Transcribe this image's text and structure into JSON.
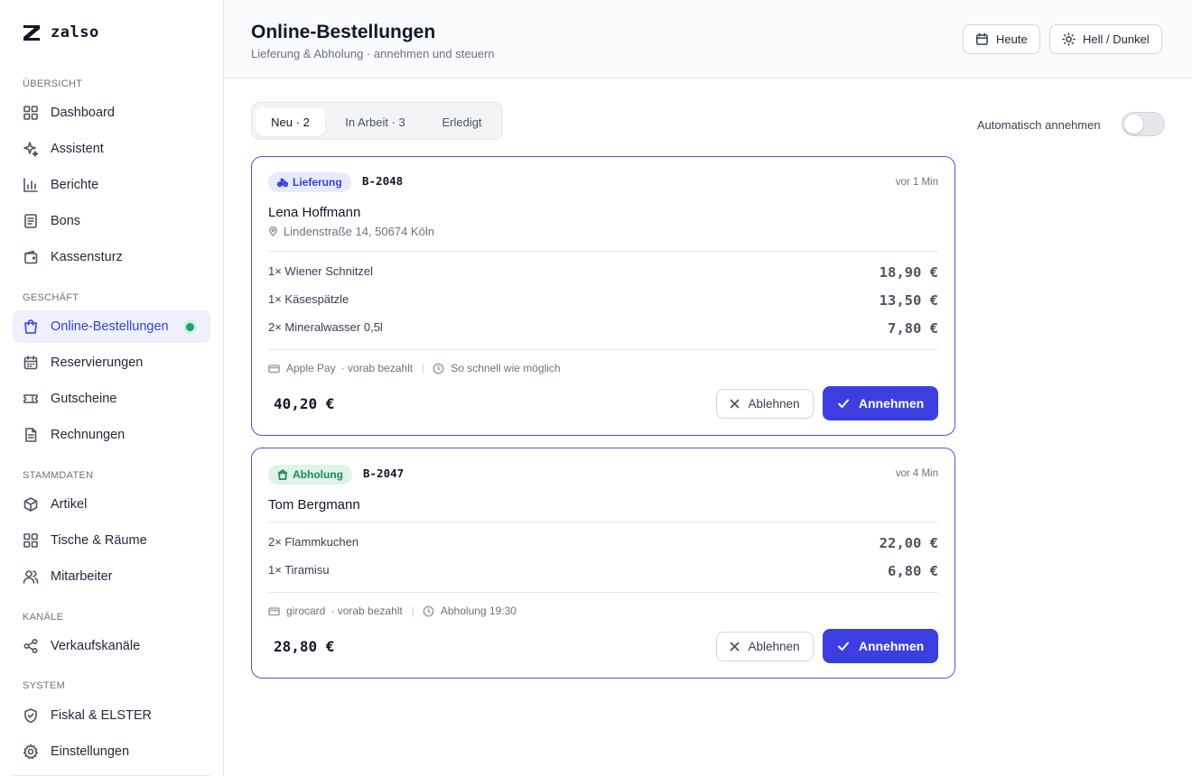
{
  "app": {
    "name": "zalso"
  },
  "sidebar": {
    "sections": [
      {
        "label": "Übersicht",
        "items": [
          {
            "label": "Dashboard",
            "icon": "grid-icon"
          },
          {
            "label": "Assistent",
            "icon": "sparkle-icon"
          },
          {
            "label": "Berichte",
            "icon": "bar-chart-icon"
          },
          {
            "label": "Bons",
            "icon": "receipt-icon"
          },
          {
            "label": "Kassensturz",
            "icon": "wallet-icon"
          }
        ]
      },
      {
        "label": "Geschäft",
        "items": [
          {
            "label": "Online-Bestellungen",
            "icon": "shopping-bag-icon",
            "active": true
          },
          {
            "label": "Reservierungen",
            "icon": "calendar-icon"
          },
          {
            "label": "Gutscheine",
            "icon": "ticket-icon"
          },
          {
            "label": "Rechnungen",
            "icon": "document-icon"
          }
        ]
      },
      {
        "label": "Stammdaten",
        "items": [
          {
            "label": "Artikel",
            "icon": "package-icon"
          },
          {
            "label": "Tische & Räume",
            "icon": "grid-icon"
          },
          {
            "label": "Mitarbeiter",
            "icon": "users-icon"
          }
        ]
      },
      {
        "label": "Kanäle",
        "items": [
          {
            "label": "Verkaufskanäle",
            "icon": "share-icon"
          }
        ]
      },
      {
        "label": "System",
        "items": [
          {
            "label": "Fiskal & ELSTER",
            "icon": "shield-icon"
          },
          {
            "label": "Einstellungen",
            "icon": "gear-icon"
          }
        ]
      }
    ]
  },
  "header": {
    "title": "Online-Bestellungen",
    "subtitle": "Lieferung & Abholung · annehmen und steuern",
    "today_button": "Heute",
    "theme_button": "Hell / Dunkel"
  },
  "tabs": [
    {
      "label": "Neu · 2",
      "active": true
    },
    {
      "label": "In Arbeit · 3",
      "active": false
    },
    {
      "label": "Erledigt",
      "active": false
    }
  ],
  "auto_accept": {
    "label": "Automatisch annehmen",
    "enabled": false
  },
  "orders": [
    {
      "type": "Lieferung",
      "number": "B-2048",
      "time": "vor 1 Min",
      "customer": "Lena Hoffmann",
      "address": "Lindenstraße 14, 50674 Köln",
      "items": [
        {
          "name": "1× Wiener Schnitzel",
          "price": "18,90 €"
        },
        {
          "name": "1× Käsespätzle",
          "price": "13,50 €"
        },
        {
          "name": "2× Mineralwasser 0,5l",
          "price": "7,80 €"
        }
      ],
      "payment": "Apple Pay",
      "paid": "· vorab bezahlt",
      "schedule": "So schnell wie möglich",
      "total": "40,20 €",
      "decline_label": "Ablehnen",
      "accept_label": "Annehmen"
    },
    {
      "type": "Abholung",
      "number": "B-2047",
      "time": "vor 4 Min",
      "customer": "Tom Bergmann",
      "items": [
        {
          "name": "2× Flammkuchen",
          "price": "22,00 €"
        },
        {
          "name": "1× Tiramisu",
          "price": "6,80 €"
        }
      ],
      "payment": "girocard",
      "paid": "· vorab bezahlt",
      "schedule": "Abholung 19:30",
      "total": "28,80 €",
      "decline_label": "Ablehnen",
      "accept_label": "Annehmen"
    }
  ],
  "colors": {
    "accent": "#3b3fe0",
    "active_nav_bg": "#eef0fc",
    "delivery_badge": "#e7e9fd",
    "pickup_badge": "#dff3e8",
    "live_dot": "#22a06b"
  }
}
